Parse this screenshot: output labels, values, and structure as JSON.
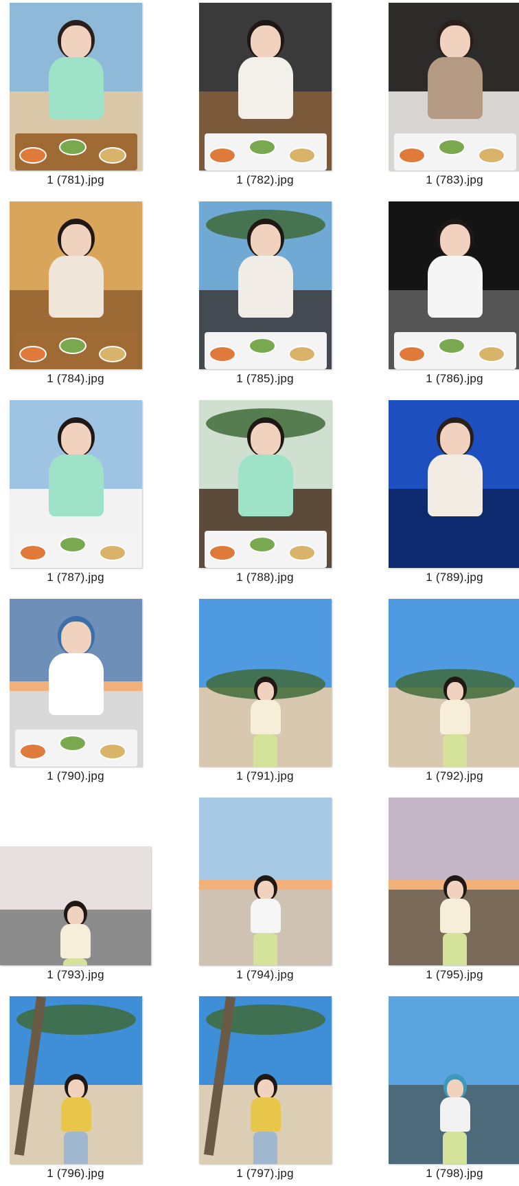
{
  "files": [
    {
      "name": "1 (781).jpg",
      "orientation": "portrait",
      "scene": "beach-cafe-day",
      "colors": {
        "sky": "#8fb9d8",
        "ground": "#d9c9a8",
        "top": "#9ee3c7",
        "hair": "#2a1f1b"
      }
    },
    {
      "name": "1 (782).jpg",
      "orientation": "portrait",
      "scene": "restaurant-night",
      "colors": {
        "sky": "#3a3a3a",
        "ground": "#7a5a3a",
        "top": "#f3f0ea",
        "hair": "#1e1713"
      }
    },
    {
      "name": "1 (783).jpg",
      "orientation": "portrait",
      "scene": "dinner-dusk",
      "colors": {
        "sky": "#2d2a2a",
        "ground": "#d8d6d2",
        "top": "#b49a82",
        "hair": "#2a1f1b"
      }
    },
    {
      "name": "1 (784).jpg",
      "orientation": "portrait",
      "scene": "cafe-indoor",
      "colors": {
        "sky": "#d8a55a",
        "ground": "#9c6a35",
        "top": "#efe5d8",
        "hair": "#1f1814"
      }
    },
    {
      "name": "1 (785).jpg",
      "orientation": "portrait",
      "scene": "garden-lunch",
      "colors": {
        "sky": "#6fa9d4",
        "ground": "#444a52",
        "top": "#f1ece6",
        "hair": "#1f1814"
      }
    },
    {
      "name": "1 (786).jpg",
      "orientation": "portrait",
      "scene": "street-night",
      "colors": {
        "sky": "#141414",
        "ground": "#555555",
        "top": "#f5f5f5",
        "hair": "#1f1814"
      }
    },
    {
      "name": "1 (787).jpg",
      "orientation": "portrait",
      "scene": "beach-breakfast",
      "colors": {
        "sky": "#9fc4e3",
        "ground": "#f2f2f2",
        "top": "#9ee3c7",
        "hair": "#1f1814"
      }
    },
    {
      "name": "1 (788).jpg",
      "orientation": "portrait",
      "scene": "resort-lunch",
      "colors": {
        "sky": "#cfe0d0",
        "ground": "#5c4a3a",
        "top": "#9ee3c7",
        "hair": "#1f1814"
      }
    },
    {
      "name": "1 (789).jpg",
      "orientation": "portrait",
      "scene": "blue-hour",
      "colors": {
        "sky": "#1d4fbf",
        "ground": "#0d2a6e",
        "top": "#f2ece4",
        "hair": "#2a1f1b"
      }
    },
    {
      "name": "1 (790).jpg",
      "orientation": "portrait",
      "scene": "sunset-reading",
      "colors": {
        "sky": "#6e8fb8",
        "ground": "#d9d9d9",
        "top": "#ffffff",
        "hair": "#3a6fa8"
      }
    },
    {
      "name": "1 (791).jpg",
      "orientation": "portrait",
      "scene": "sand-dune",
      "colors": {
        "sky": "#4f9ae0",
        "ground": "#d8c8b0",
        "top": "#f6eed8",
        "hair": "#1f1814"
      }
    },
    {
      "name": "1 (792).jpg",
      "orientation": "portrait",
      "scene": "sand-dune",
      "colors": {
        "sky": "#4f9ae0",
        "ground": "#d8c8b0",
        "top": "#f6eed8",
        "hair": "#1f1814"
      }
    },
    {
      "name": "1 (793).jpg",
      "orientation": "landscape",
      "scene": "shop-front",
      "colors": {
        "sky": "#e8e0e0",
        "ground": "#8c8c8c",
        "top": "#f6eed8",
        "hair": "#1f1814"
      }
    },
    {
      "name": "1 (794).jpg",
      "orientation": "portrait",
      "scene": "sunset-beach",
      "colors": {
        "sky": "#a7c9e6",
        "ground": "#cfc2b2",
        "top": "#f6f6f6",
        "hair": "#1f1814"
      }
    },
    {
      "name": "1 (795).jpg",
      "orientation": "portrait",
      "scene": "sunset-pavilion",
      "colors": {
        "sky": "#c4b6c7",
        "ground": "#7a6a5a",
        "top": "#f6eed8",
        "hair": "#1f1814"
      }
    },
    {
      "name": "1 (796).jpg",
      "orientation": "portrait",
      "scene": "palm-beach",
      "colors": {
        "sky": "#3f8fd8",
        "ground": "#dccdb5",
        "top": "#e8c64a",
        "hair": "#1f1814"
      }
    },
    {
      "name": "1 (797).jpg",
      "orientation": "portrait",
      "scene": "palm-beach",
      "colors": {
        "sky": "#3f8fd8",
        "ground": "#dccdb5",
        "top": "#e8c64a",
        "hair": "#1f1814"
      }
    },
    {
      "name": "1 (798).jpg",
      "orientation": "portrait",
      "scene": "rocky-shore",
      "colors": {
        "sky": "#5aa4e0",
        "ground": "#4c6a7a",
        "top": "#f2f2f2",
        "hair": "#3a9ab8"
      }
    }
  ]
}
